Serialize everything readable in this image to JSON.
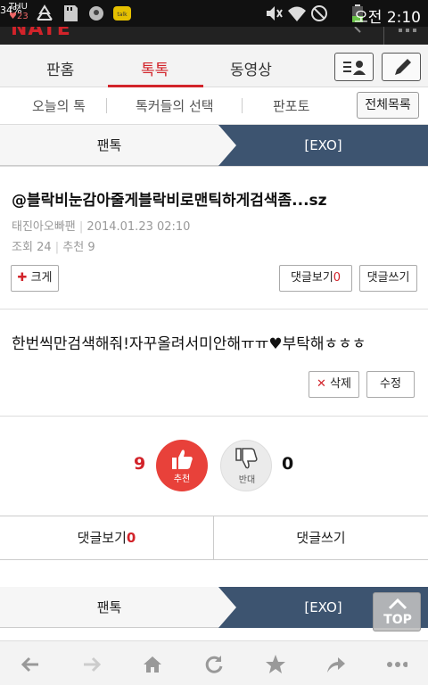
{
  "status_bar": {
    "day": "THU",
    "date": "23",
    "battery": "34%",
    "time": "오전 2:10"
  },
  "header": {
    "brand": "NATE"
  },
  "nav": {
    "tabs": [
      "판홈",
      "톡톡",
      "동영상"
    ],
    "active": "톡톡"
  },
  "subnav": {
    "items": [
      "오늘의 톡",
      "톡커들의 선택",
      "판포토"
    ],
    "all_list": "전체목록"
  },
  "breadcrumb": {
    "left": "팬톡",
    "right": "[EXO]"
  },
  "post": {
    "title": "@블락비눈감아줄게블락비로맨틱하게검색좀...sz",
    "author": "태진아오빠팬",
    "datetime": "2014.01.23 02:10",
    "views_label": "조회",
    "views": "24",
    "recommend_label": "추천",
    "recommend": "9",
    "enlarge_label": "크게",
    "view_comments_label": "댓글보기",
    "comment_count": "0",
    "write_comment_label": "댓글쓰기",
    "body": "한번씩만검색해줘!자꾸올려서미안해ㅠㅠ♥부탁해ㅎㅎㅎ",
    "delete_label": "삭제",
    "edit_label": "수정"
  },
  "votes": {
    "up_count": "9",
    "up_label": "추천",
    "down_count": "0",
    "down_label": "반대"
  },
  "comment_bar": {
    "view_label": "댓글보기",
    "count": "0",
    "write_label": "댓글쓰기"
  },
  "breadcrumb_bottom": {
    "left": "팬톡",
    "right": "[EXO]"
  },
  "top_button": "TOP",
  "colors": {
    "accent": "#d2232a",
    "breadcrumb_active": "#3d5470"
  }
}
